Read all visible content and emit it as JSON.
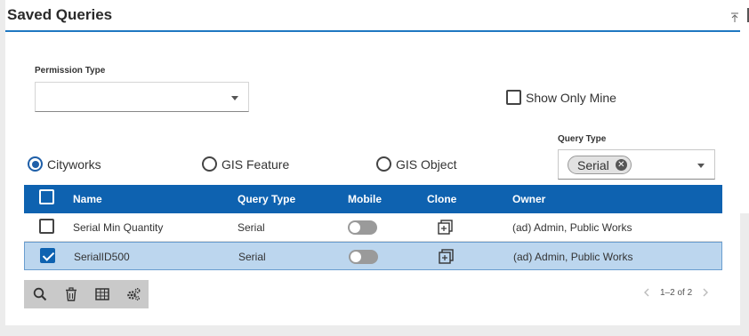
{
  "header": {
    "title": "Saved Queries"
  },
  "permission": {
    "label": "Permission Type",
    "value": ""
  },
  "show_only_mine": {
    "label": "Show Only Mine",
    "checked": false
  },
  "query_type_filter": {
    "label": "Query Type",
    "chips": [
      "Serial"
    ]
  },
  "radios": [
    {
      "label": "Cityworks",
      "selected": true
    },
    {
      "label": "GIS Feature",
      "selected": false
    },
    {
      "label": "GIS Object",
      "selected": false
    }
  ],
  "table": {
    "columns": [
      "Name",
      "Query Type",
      "Mobile",
      "Clone",
      "Owner"
    ],
    "rows": [
      {
        "name": "Serial Min Quantity",
        "query_type": "Serial",
        "mobile": false,
        "owner": "(ad) Admin, Public Works",
        "checked": false
      },
      {
        "name": "SerialID500",
        "query_type": "Serial",
        "mobile": false,
        "owner": "(ad) Admin, Public Works",
        "checked": true
      }
    ]
  },
  "toolbar": {
    "icons": [
      "search-icon",
      "delete-icon",
      "table-icon",
      "settings-icon"
    ]
  },
  "pager": {
    "text": "1–2 of 2"
  },
  "colors": {
    "accent": "#0e62b0",
    "selected_row": "#bcd6ee",
    "toolbar": "#c9c9c9"
  }
}
